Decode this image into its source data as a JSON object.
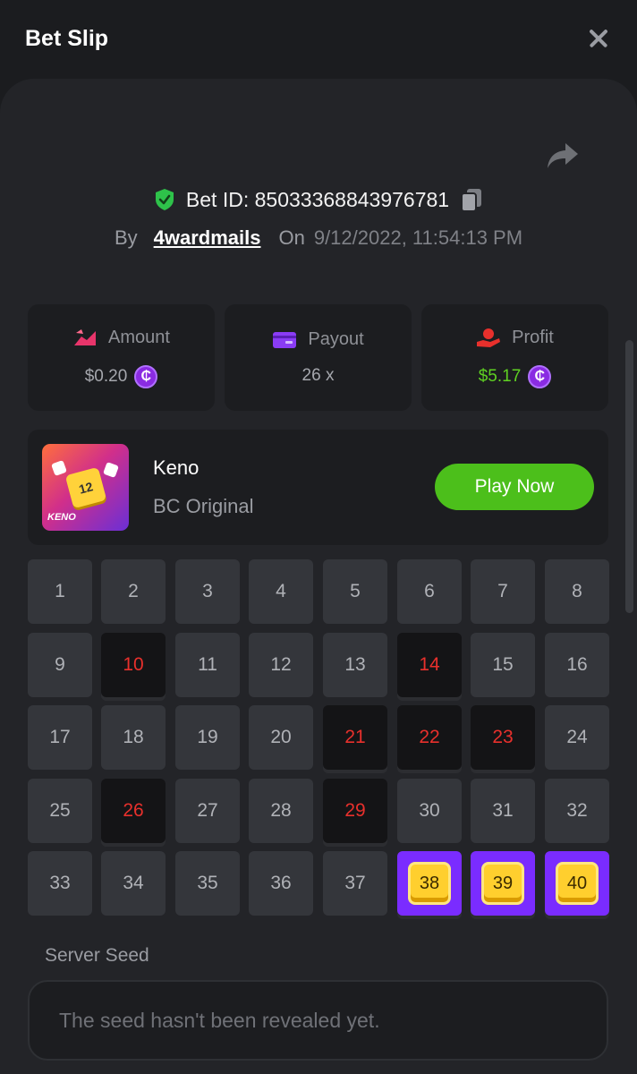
{
  "header": {
    "title": "Bet Slip"
  },
  "bet": {
    "id_label": "Bet ID: 85033368843976781",
    "by_label": "By",
    "user": "4wardmails",
    "on_label": "On",
    "date": "9/12/2022, 11:54:13 PM"
  },
  "stats": {
    "amount": {
      "label": "Amount",
      "value": "$0.20"
    },
    "payout": {
      "label": "Payout",
      "value": "26 x"
    },
    "profit": {
      "label": "Profit",
      "value": "$5.17"
    },
    "coin_symbol": "₵"
  },
  "game": {
    "name": "Keno",
    "provider": "BC Original",
    "play_label": "Play Now",
    "thumb_label": "KENO",
    "thumb_die": "12"
  },
  "keno": {
    "cells": [
      {
        "n": "1",
        "s": "normal"
      },
      {
        "n": "2",
        "s": "normal"
      },
      {
        "n": "3",
        "s": "normal"
      },
      {
        "n": "4",
        "s": "normal"
      },
      {
        "n": "5",
        "s": "normal"
      },
      {
        "n": "6",
        "s": "normal"
      },
      {
        "n": "7",
        "s": "normal"
      },
      {
        "n": "8",
        "s": "normal"
      },
      {
        "n": "9",
        "s": "normal"
      },
      {
        "n": "10",
        "s": "miss"
      },
      {
        "n": "11",
        "s": "normal"
      },
      {
        "n": "12",
        "s": "normal"
      },
      {
        "n": "13",
        "s": "normal"
      },
      {
        "n": "14",
        "s": "miss"
      },
      {
        "n": "15",
        "s": "normal"
      },
      {
        "n": "16",
        "s": "normal"
      },
      {
        "n": "17",
        "s": "normal"
      },
      {
        "n": "18",
        "s": "normal"
      },
      {
        "n": "19",
        "s": "normal"
      },
      {
        "n": "20",
        "s": "normal"
      },
      {
        "n": "21",
        "s": "miss"
      },
      {
        "n": "22",
        "s": "miss"
      },
      {
        "n": "23",
        "s": "miss"
      },
      {
        "n": "24",
        "s": "normal"
      },
      {
        "n": "25",
        "s": "normal"
      },
      {
        "n": "26",
        "s": "miss"
      },
      {
        "n": "27",
        "s": "normal"
      },
      {
        "n": "28",
        "s": "normal"
      },
      {
        "n": "29",
        "s": "miss"
      },
      {
        "n": "30",
        "s": "normal"
      },
      {
        "n": "31",
        "s": "normal"
      },
      {
        "n": "32",
        "s": "normal"
      },
      {
        "n": "33",
        "s": "normal"
      },
      {
        "n": "34",
        "s": "normal"
      },
      {
        "n": "35",
        "s": "normal"
      },
      {
        "n": "36",
        "s": "normal"
      },
      {
        "n": "37",
        "s": "normal"
      },
      {
        "n": "38",
        "s": "hit"
      },
      {
        "n": "39",
        "s": "hit"
      },
      {
        "n": "40",
        "s": "hit"
      }
    ]
  },
  "seed": {
    "label": "Server Seed",
    "placeholder": "The seed hasn't been revealed yet."
  },
  "colors": {
    "accent_green": "#4cbf1b",
    "profit_green": "#5fd122",
    "miss_red": "#e8302c",
    "hit_purple": "#7a2cff",
    "coin_purple": "#8a2be2"
  }
}
